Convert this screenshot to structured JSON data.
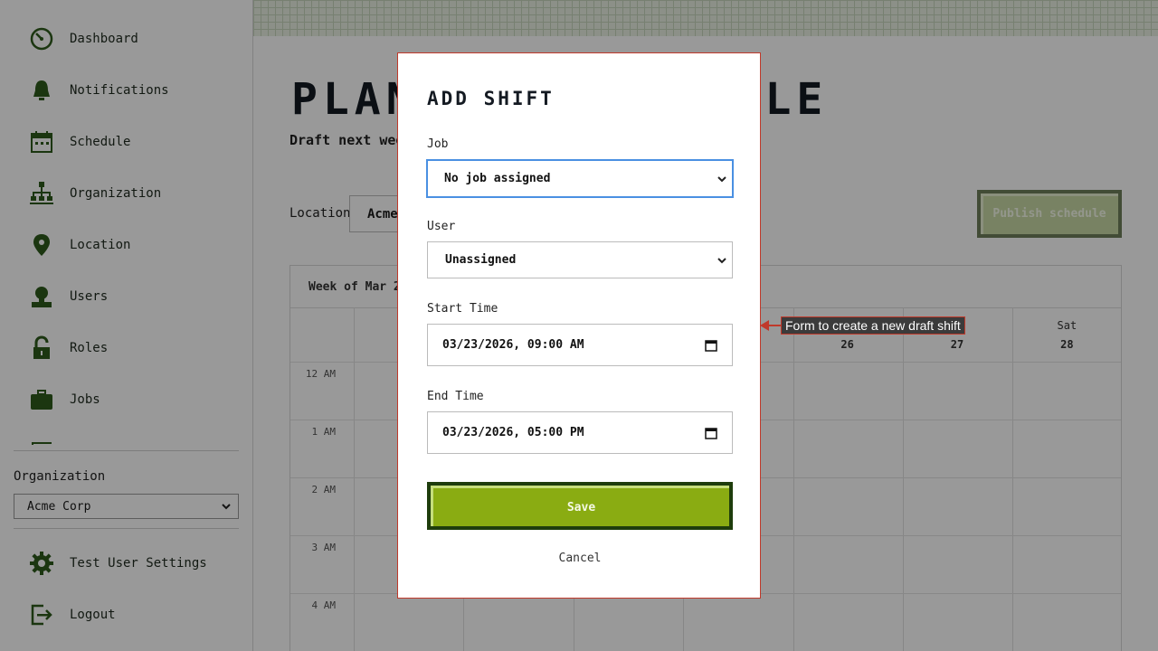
{
  "sidebar": {
    "items": [
      {
        "label": "Dashboard",
        "icon": "dashboard-icon"
      },
      {
        "label": "Notifications",
        "icon": "bell-icon"
      },
      {
        "label": "Schedule",
        "icon": "calendar-icon"
      },
      {
        "label": "Organization",
        "icon": "org-chart-icon"
      },
      {
        "label": "Location",
        "icon": "location-pin-icon"
      },
      {
        "label": "Users",
        "icon": "user-icon"
      },
      {
        "label": "Roles",
        "icon": "lock-icon"
      },
      {
        "label": "Jobs",
        "icon": "briefcase-icon"
      }
    ],
    "organization_title": "Organization",
    "organization_value": "Acme Corp",
    "settings_label": "Test User Settings",
    "logout_label": "Logout",
    "icon_color": "#2d5a1b"
  },
  "page": {
    "title": "PLANNING SCHEDULE",
    "subtitle": "Draft next week",
    "location_label": "Location",
    "location_value": "Acme",
    "publish_label": "Publish schedule"
  },
  "calendar": {
    "week_label": "Week of Mar 22",
    "days": [
      {
        "name": "",
        "num": ""
      },
      {
        "name": "",
        "num": ""
      },
      {
        "name": "",
        "num": ""
      },
      {
        "name": "",
        "num": ""
      },
      {
        "name": "",
        "num": "26"
      },
      {
        "name": "",
        "num": "27"
      },
      {
        "name": "Sat",
        "num": "28"
      }
    ],
    "hours": [
      "12 AM",
      "1 AM",
      "2 AM",
      "3 AM",
      "4 AM"
    ]
  },
  "modal": {
    "title": "ADD SHIFT",
    "job_label": "Job",
    "job_value": "No job assigned",
    "user_label": "User",
    "user_value": "Unassigned",
    "start_label": "Start Time",
    "start_value": "03/23/2026, 09:00 AM",
    "end_label": "End Time",
    "end_value": "03/23/2026, 05:00 PM",
    "save_label": "Save",
    "cancel_label": "Cancel"
  },
  "annotation": {
    "text": "Form to create a new draft shift",
    "color": "#c0392b"
  }
}
